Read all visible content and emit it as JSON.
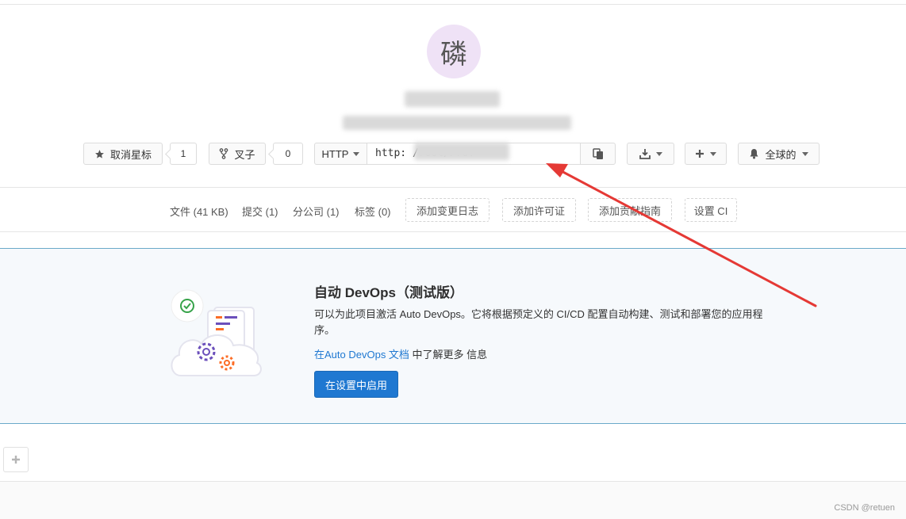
{
  "project": {
    "avatar_letter": "磷"
  },
  "actions": {
    "star_label": "取消星标",
    "star_count": "1",
    "fork_label": "叉子",
    "fork_count": "0",
    "clone_protocol": "HTTP",
    "clone_url": "http:              /root/Pro:",
    "notify_label": "全球的"
  },
  "stats": {
    "files": "文件 (41 KB)",
    "commits": "提交 (1)",
    "branches": "分公司 (1)",
    "tags": "标签 (0)",
    "add_changelog": "添加变更日志",
    "add_license": "添加许可证",
    "add_contributing": "添加贡献指南",
    "setup_ci": "设置 CI"
  },
  "devops": {
    "title": "自动 DevOps（测试版）",
    "description": "可以为此项目激活 Auto DevOps。它将根据预定义的 CI/CD 配置自动构建、测试和部署您的应用程序。",
    "learn_link": "在Auto DevOps 文档",
    "learn_suffix": " 中了解更多 信息",
    "enable_button": "在设置中启用"
  },
  "watermark": "CSDN @retuen",
  "colors": {
    "primary": "#1f78d1",
    "annotation_arrow": "#e53935",
    "avatar_bg": "#efe2f6"
  },
  "icons": {
    "star": "star-icon",
    "fork": "fork-icon",
    "copy": "clipboard-icon",
    "download": "download-icon",
    "plus": "plus-icon",
    "bell": "bell-icon"
  }
}
